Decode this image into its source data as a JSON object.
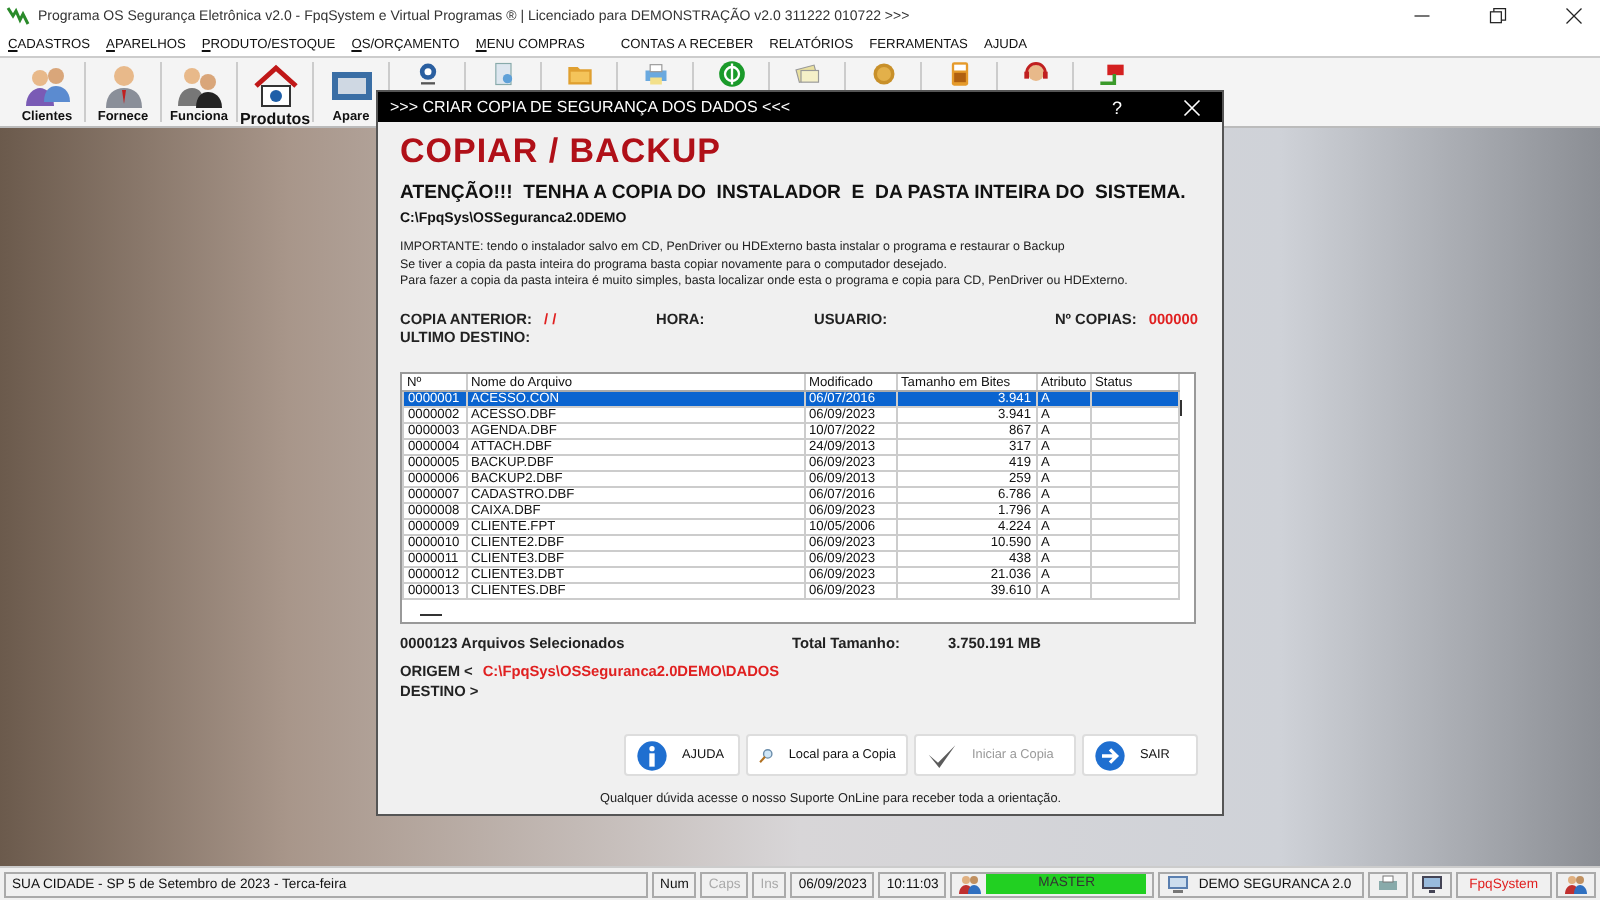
{
  "window": {
    "title": "Programa OS Segurança Eletrônica v2.0 - FpqSystem e Virtual Programas ® | Licenciado para  DEMONSTRAÇÃO v2.0 311222 010722 >>>"
  },
  "menu": [
    {
      "label": "CADASTROS",
      "underlined": true
    },
    {
      "label": "APARELHOS",
      "underlined": true
    },
    {
      "label": "PRODUTO/ESTOQUE",
      "underlined": true
    },
    {
      "label": "OS/ORÇAMENTO",
      "underlined": true
    },
    {
      "label": "MENU COMPRAS",
      "underlined": true
    },
    {
      "label": "CONTAS A RECEBER",
      "underlined": false
    },
    {
      "label": "RELATÓRIOS",
      "underlined": false
    },
    {
      "label": "FERRAMENTAS",
      "underlined": false
    },
    {
      "label": "AJUDA",
      "underlined": false
    }
  ],
  "toolbar": [
    {
      "kind": "people",
      "label": "Clientes"
    },
    {
      "kind": "person",
      "label": "Fornece"
    },
    {
      "kind": "couple",
      "label": "Funciona"
    },
    {
      "kind": "house",
      "label": "Produtos"
    },
    {
      "kind": "device",
      "label": "Apare"
    },
    {
      "kind": "camera"
    },
    {
      "kind": "document"
    },
    {
      "kind": "folder"
    },
    {
      "kind": "printer"
    },
    {
      "kind": "money"
    },
    {
      "kind": "cards"
    },
    {
      "kind": "coins"
    },
    {
      "kind": "calculator"
    },
    {
      "kind": "support"
    },
    {
      "kind": "exit"
    }
  ],
  "dialog": {
    "title": ">>> CRIAR COPIA DE SEGURANÇA DOS DADOS <<<",
    "help": "?",
    "heading": "COPIAR / BACKUP",
    "warning": "ATENÇÃO!!!  TENHA A COPIA DO  INSTALADOR  E  DA PASTA INTEIRA DO  SISTEMA.",
    "path": "C:\\FpqSys\\OSSeguranca2.0DEMO",
    "notes": [
      "IMPORTANTE: tendo o instalador salvo em CD, PenDriver ou HDExterno basta instalar o programa e restaurar o Backup",
      "Se tiver a copia da pasta inteira do programa basta copiar novamente para o computador desejado.",
      "Para fazer a copia da pasta inteira é muito simples, basta localizar onde esta o programa e copia para CD, PenDriver ou HDExterno."
    ],
    "info": [
      {
        "label": "COPIA ANTERIOR:",
        "value": "/ /"
      },
      {
        "label": "HORA:"
      },
      {
        "label": "USUARIO:"
      },
      {
        "label": "Nº COPIAS:",
        "value": "000000"
      }
    ],
    "last_destination": "ULTIMO DESTINO:",
    "table": {
      "columns": [
        "Nº",
        "Nome do Arquivo",
        "Modificado",
        "Tamanho em Bites",
        "Atributo",
        "Status"
      ],
      "rows": [
        {
          "selected": true,
          "cells": [
            "0000001",
            "ACESSO.CON",
            "06/07/2016",
            "3.941",
            "A"
          ]
        },
        {
          "selected": false,
          "cells": [
            "0000002",
            "ACESSO.DBF",
            "06/09/2023",
            "3.941",
            "A"
          ]
        },
        {
          "selected": false,
          "cells": [
            "0000003",
            "AGENDA.DBF",
            "10/07/2022",
            "867",
            "A"
          ]
        },
        {
          "selected": false,
          "cells": [
            "0000004",
            "ATTACH.DBF",
            "24/09/2013",
            "317",
            "A"
          ]
        },
        {
          "selected": false,
          "cells": [
            "0000005",
            "BACKUP.DBF",
            "06/09/2023",
            "419",
            "A"
          ]
        },
        {
          "selected": false,
          "cells": [
            "0000006",
            "BACKUP2.DBF",
            "06/09/2013",
            "259",
            "A"
          ]
        },
        {
          "selected": false,
          "cells": [
            "0000007",
            "CADASTRO.DBF",
            "06/07/2016",
            "6.786",
            "A"
          ]
        },
        {
          "selected": false,
          "cells": [
            "0000008",
            "CAIXA.DBF",
            "06/09/2023",
            "1.796",
            "A"
          ]
        },
        {
          "selected": false,
          "cells": [
            "0000009",
            "CLIENTE.FPT",
            "10/05/2006",
            "4.224",
            "A"
          ]
        },
        {
          "selected": false,
          "cells": [
            "0000010",
            "CLIENTE2.DBF",
            "06/09/2023",
            "10.590",
            "A"
          ]
        },
        {
          "selected": false,
          "cells": [
            "0000011",
            "CLIENTE3.DBF",
            "06/09/2023",
            "438",
            "A"
          ]
        },
        {
          "selected": false,
          "cells": [
            "0000012",
            "CLIENTE3.DBT",
            "06/09/2023",
            "21.036",
            "A"
          ]
        },
        {
          "selected": false,
          "cells": [
            "0000013",
            "CLIENTES.DBF",
            "06/09/2023",
            "39.610",
            "A"
          ]
        }
      ]
    },
    "selected_count": "0000123 Arquivos  Selecionados",
    "total_label": "Total Tamanho:",
    "total_value": "3.750.191 MB",
    "origin_label": "ORIGEM  <",
    "origin_value": "C:\\FpqSys\\OSSeguranca2.0DEMO\\DADOS",
    "destination_label": "DESTINO >",
    "buttons": [
      {
        "kind": "info",
        "label": "AJUDA",
        "disabled": false
      },
      {
        "kind": "search",
        "label": "Local para a Copia",
        "disabled": false
      },
      {
        "kind": "check",
        "label": "Iniciar a Copia",
        "disabled": true
      },
      {
        "kind": "arrow",
        "label": "SAIR",
        "disabled": false
      }
    ],
    "footer": "Qualquer dúvida acesse o nosso Suporte OnLine para receber toda a orientação."
  },
  "status_bar": [
    {
      "kind": "text",
      "label": "SUA CIDADE - SP  5 de Setembro de 2023 - Terca-feira"
    },
    {
      "kind": "key",
      "label": "Num",
      "on": true
    },
    {
      "kind": "key",
      "label": "Caps",
      "on": false
    },
    {
      "kind": "key",
      "label": "Ins",
      "on": false
    },
    {
      "kind": "text",
      "label": "06/09/2023"
    },
    {
      "kind": "text",
      "label": "10:11:03"
    },
    {
      "kind": "user",
      "label": "MASTER"
    },
    {
      "kind": "system",
      "label": "DEMO SEGURANCA 2.0"
    },
    {
      "kind": "printer"
    },
    {
      "kind": "monitor"
    },
    {
      "kind": "brand",
      "label": "FpqSystem"
    },
    {
      "kind": "users"
    }
  ]
}
